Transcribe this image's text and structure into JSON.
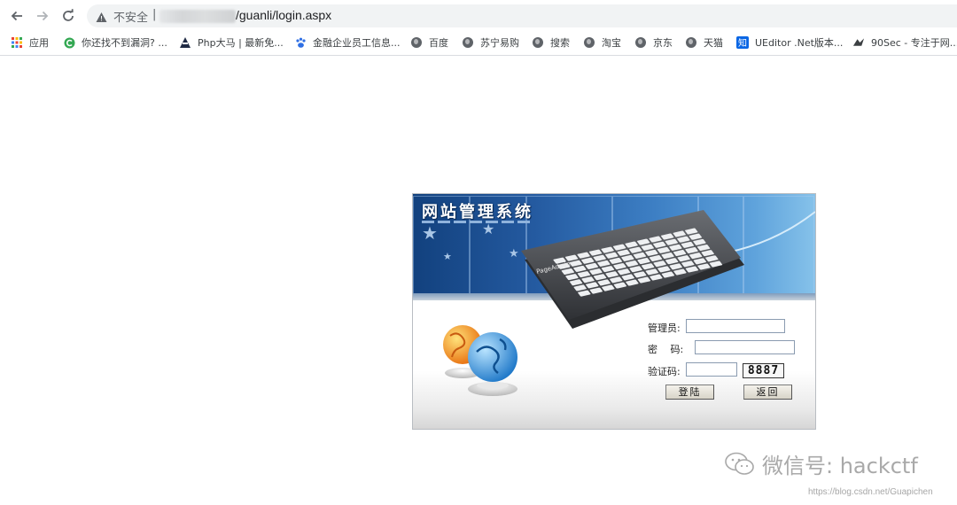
{
  "browser": {
    "omnibox": {
      "insecure_label": "不安全",
      "separator": "|",
      "url_path": "/guanli/login.aspx"
    },
    "bookmarks": [
      {
        "label": "应用",
        "icon": "apps-grid-icon"
      },
      {
        "label": "你还找不到漏洞? ...",
        "icon": "green-c-icon"
      },
      {
        "label": "Php大马 | 最新免...",
        "icon": "hacker-icon"
      },
      {
        "label": "金融企业员工信息...",
        "icon": "baidu-paw-icon"
      },
      {
        "label": "百度",
        "icon": "globe-icon"
      },
      {
        "label": "苏宁易购",
        "icon": "globe-icon"
      },
      {
        "label": "搜索",
        "icon": "globe-icon"
      },
      {
        "label": "淘宝",
        "icon": "globe-icon"
      },
      {
        "label": "京东",
        "icon": "globe-icon"
      },
      {
        "label": "天猫",
        "icon": "globe-icon"
      },
      {
        "label": "UEditor .Net版本...",
        "icon": "zhihu-icon"
      },
      {
        "label": "90Sec - 专注于网...",
        "icon": "90sec-icon"
      }
    ]
  },
  "login": {
    "title": "网站管理系统",
    "keyboard_brand": "PageAdmin",
    "admin_label": "管理员:",
    "admin_value": "",
    "password_label": "密　 码:",
    "password_value": "",
    "captcha_label": "验证码:",
    "captcha_value": "",
    "captcha_code": "8887",
    "login_button": "登陆",
    "back_button": "返回"
  },
  "watermark": {
    "text": "微信号: hackctf",
    "url": "https://blog.csdn.net/Guapichen"
  },
  "colors": {
    "banner_dark": "#12417e",
    "banner_light": "#86c2ea",
    "omnibox_bg": "#f1f3f4"
  }
}
